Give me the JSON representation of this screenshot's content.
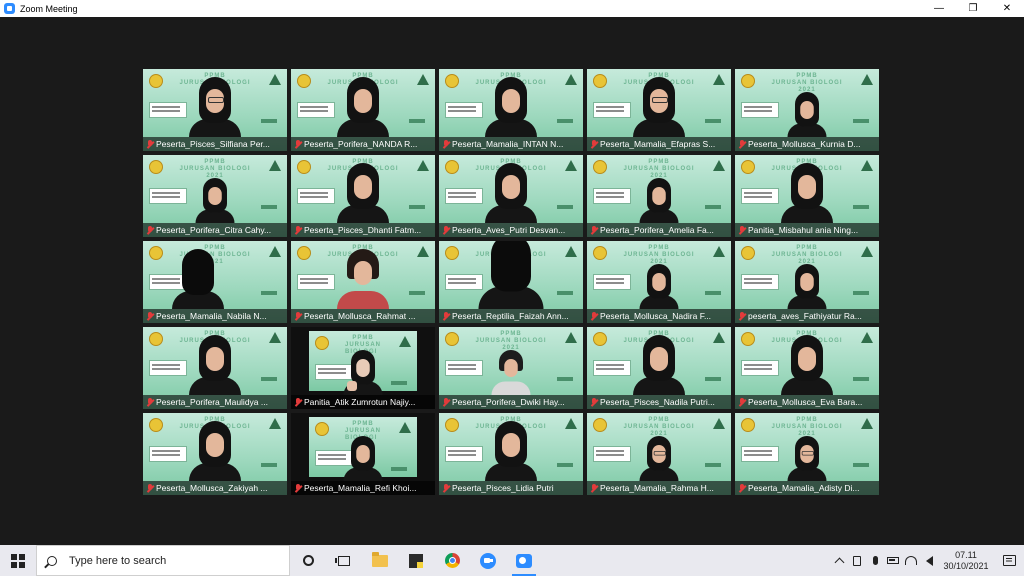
{
  "window": {
    "title": "Zoom Meeting",
    "minimize_glyph": "—",
    "restore_glyph": "❐",
    "close_glyph": "✕"
  },
  "slide": {
    "banner_line1": "PPMB",
    "banner_line2": "JURUSAN BIOLOGI",
    "banner_line3": "2021"
  },
  "participants": [
    {
      "name": "Peserta_Pisces_Silfiana Per...",
      "video": "person",
      "variant": "glasses"
    },
    {
      "name": "Peserta_Porifera_NANDA R...",
      "video": "person",
      "variant": ""
    },
    {
      "name": "Peserta_Mamalia_INTAN N...",
      "video": "person",
      "variant": ""
    },
    {
      "name": "Peserta_Mamalia_Efapras S...",
      "video": "person",
      "variant": "glasses"
    },
    {
      "name": "Peserta_Mollusca_Kurnia D...",
      "video": "person",
      "variant": "small"
    },
    {
      "name": "Peserta_Porifera_Citra Cahy...",
      "video": "person",
      "variant": "small"
    },
    {
      "name": "Peserta_Pisces_Dhanti Fatm...",
      "video": "person",
      "variant": ""
    },
    {
      "name": "Peserta_Aves_Putri Desvan...",
      "video": "person",
      "variant": ""
    },
    {
      "name": "Peserta_Porifera_Amelia Fa...",
      "video": "person",
      "variant": "small"
    },
    {
      "name": "Panitia_Misbahul ania Ning...",
      "video": "person",
      "variant": ""
    },
    {
      "name": "Peserta_Mamalia_Nabila N...",
      "video": "person",
      "variant": "back off"
    },
    {
      "name": "Peserta_Mollusca_Rahmat ...",
      "video": "person",
      "variant": "hair"
    },
    {
      "name": "Peserta_Reptilia_Faizah Ann...",
      "video": "person",
      "variant": "back big"
    },
    {
      "name": "Peserta_Mollusca_Nadira F...",
      "video": "person",
      "variant": "small"
    },
    {
      "name": "peserta_aves_Fathiyatur Ra...",
      "video": "person",
      "variant": "small"
    },
    {
      "name": "Peserta_Porifera_Maulidya ...",
      "video": "person",
      "variant": ""
    },
    {
      "name": "Panitia_Atik Zumrotun Najiy...",
      "video": "dark",
      "variant": "small pale"
    },
    {
      "name": "Peserta_Porifera_Dwiki Hay...",
      "video": "person",
      "variant": "hair2 small"
    },
    {
      "name": "Peserta_Pisces_Nadila Putri...",
      "video": "person",
      "variant": ""
    },
    {
      "name": "Peserta_Mollusca_Eva Bara...",
      "video": "person",
      "variant": ""
    },
    {
      "name": "Peserta_Mollusca_Zakiyah ...",
      "video": "person",
      "variant": ""
    },
    {
      "name": "Peserta_Mamalia_Refi Khoi...",
      "video": "dark",
      "variant": "small"
    },
    {
      "name": "Peserta_Pisces_Lidia Putri",
      "video": "person",
      "variant": ""
    },
    {
      "name": "Peserta_Mamalia_Rahma H...",
      "video": "person",
      "variant": "small glasses"
    },
    {
      "name": "Peserta_Mamalia_Adisty Di...",
      "video": "person",
      "variant": "small glasses"
    }
  ],
  "taskbar": {
    "search_placeholder": "Type here to search",
    "time": "07.11",
    "date": "30/10/2021"
  },
  "colors": {
    "accent": "#2d8cff",
    "muted_mic": "#e23b3b"
  }
}
